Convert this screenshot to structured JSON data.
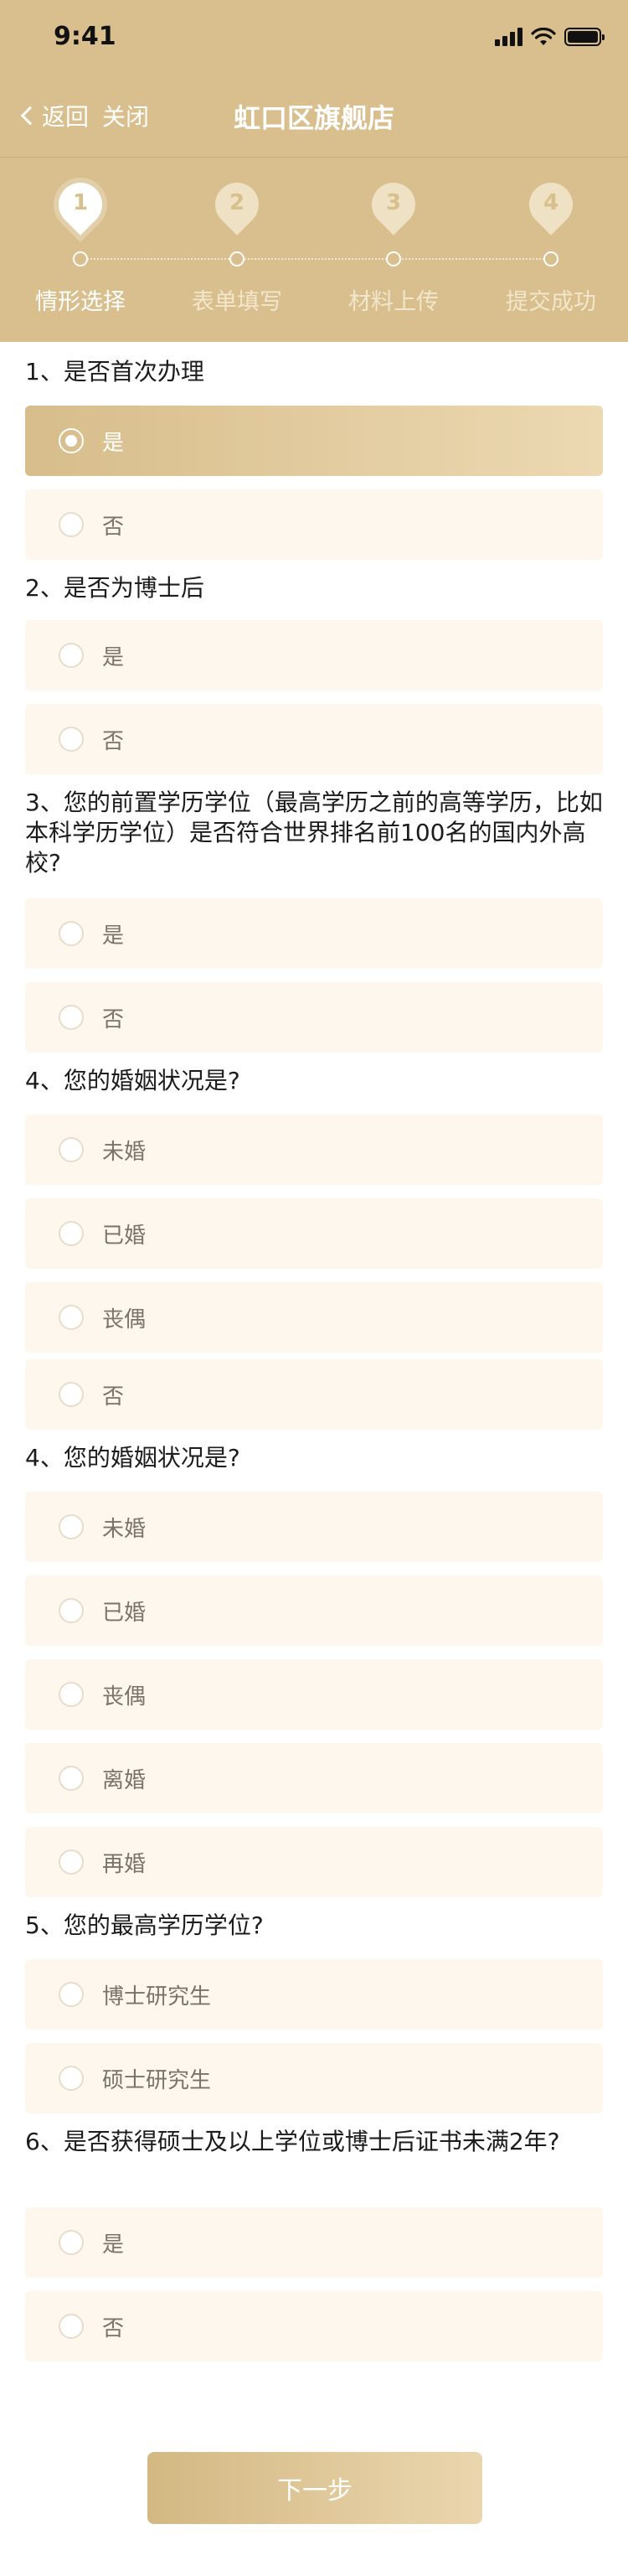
{
  "statusbar": {
    "time": "9:41"
  },
  "nav": {
    "back_label": "返回",
    "close_label": "关闭",
    "title": "虹口区旗舰店"
  },
  "steps": [
    {
      "num": "1",
      "label": "情形选择",
      "active": true
    },
    {
      "num": "2",
      "label": "表单填写",
      "active": false
    },
    {
      "num": "3",
      "label": "材料上传",
      "active": false
    },
    {
      "num": "4",
      "label": "提交成功",
      "active": false
    }
  ],
  "questions": [
    {
      "title": "1、是否首次办理",
      "options": [
        "是",
        "否"
      ],
      "selected": 0
    },
    {
      "title": "2、是否为博士后",
      "options": [
        "是",
        "否"
      ],
      "selected": -1
    },
    {
      "title": "3、您的前置学历学位（最高学历之前的高等学历，比如本科学历学位）是否符合世界排名前100名的国内外高校?",
      "options": [
        "是",
        "否"
      ],
      "selected": -1
    },
    {
      "title": "4、您的婚姻状况是?",
      "options": [
        "未婚",
        "已婚",
        "丧偶",
        "否"
      ],
      "selected": -1
    },
    {
      "title": "4、您的婚姻状况是?",
      "options": [
        "未婚",
        "已婚",
        "丧偶",
        "离婚",
        "再婚"
      ],
      "selected": -1
    },
    {
      "title": "5、您的最高学历学位?",
      "options": [
        "博士研究生",
        "硕士研究生"
      ],
      "selected": -1
    },
    {
      "title": "6、是否获得硕士及以上学位或博士后证书未满2年?",
      "options": [
        "是",
        "否"
      ],
      "selected": -1
    }
  ],
  "footer": {
    "next_label": "下一步"
  },
  "colors": {
    "brand_gold": "#d8bf8d",
    "option_bg": "#fdf7ee"
  }
}
